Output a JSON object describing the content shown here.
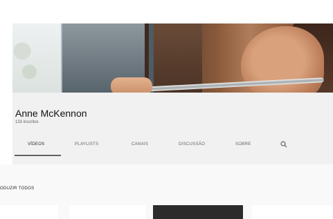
{
  "channel": {
    "name": "Anne McKennon",
    "subscribers": "133 inscritos"
  },
  "tabs": [
    {
      "label": "VÍDEOS",
      "active": true
    },
    {
      "label": "PLAYLISTS",
      "active": false
    },
    {
      "label": "CANAIS",
      "active": false
    },
    {
      "label": "DISCUSSÃO",
      "active": false
    },
    {
      "label": "SOBRE",
      "active": false
    }
  ],
  "search_icon": "search-icon",
  "section": {
    "play_all_label": "ODUZIR TODOS"
  },
  "colors": {
    "header_bg": "#f1f1f1",
    "tab_underline": "#606060"
  }
}
